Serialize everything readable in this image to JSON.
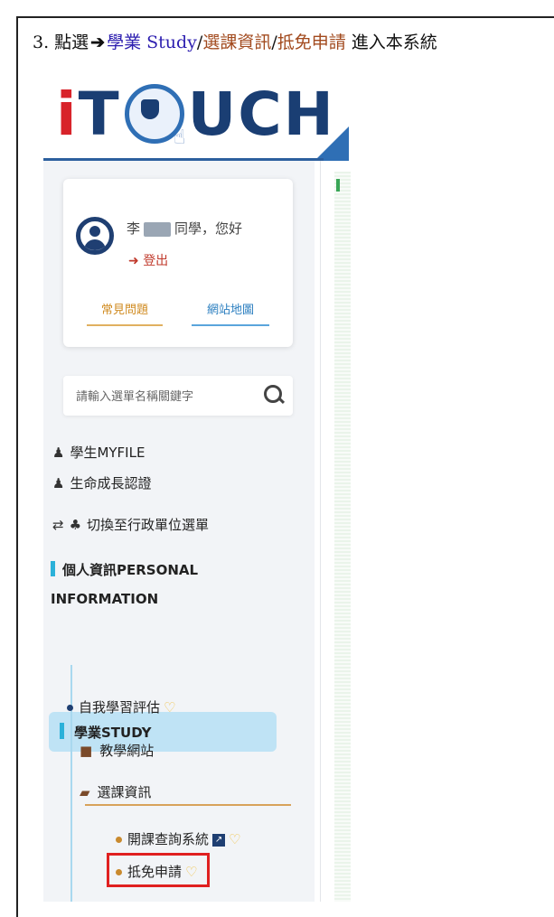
{
  "instruction": {
    "prefix": "3. 點選",
    "arrow": "➔",
    "part1": "學業 Study",
    "sep1": "/",
    "part2": "選課資訊",
    "sep2": "/",
    "part3": "抵免申請",
    "suffix": " 進入本系統"
  },
  "logo": {
    "i": "i",
    "t": "T",
    "rest": "UCH"
  },
  "user": {
    "surname": "李",
    "greeting": "同學，您好",
    "logout": "登出"
  },
  "links": {
    "faq": "常見問題",
    "sitemap": "網站地圖"
  },
  "search": {
    "placeholder": "請輸入選單名稱關鍵字"
  },
  "menu": {
    "myfile": "學生MYFILE",
    "life": "生命成長認證",
    "switch": "切換至行政單位選單"
  },
  "sections": {
    "personal_line1": "個人資訊PERSONAL",
    "personal_line2": "INFORMATION",
    "study": "學業STUDY"
  },
  "study_items": {
    "self_eval": "自我學習評估",
    "teaching_site": "教學網站",
    "course_info": "選課資訊",
    "course_query": "開課查詢系統",
    "credit_waiver": "抵免申請"
  },
  "colors": {
    "accent_blue": "#2bb1d9",
    "highlight_red": "#e02020",
    "study_bg": "#bfe3f5"
  }
}
